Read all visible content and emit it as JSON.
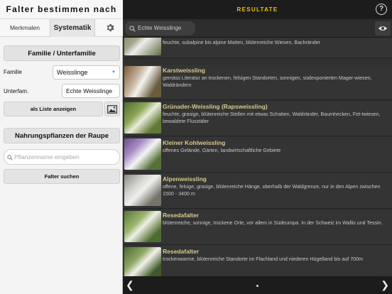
{
  "left_panel": {
    "title": "Falter bestimmen nach",
    "tabs": {
      "merkmalen": "Merkmalen",
      "systematik": "Systematik"
    },
    "section_family": "Familie / Unterfamilie",
    "familie_label": "Familie",
    "familie_value": "Weisslinge",
    "unterfam_label": "Unterfam.",
    "unterfam_value": "Echte Weisslinge",
    "list_button": "als Liste anzeigen",
    "section_plants": "Nahrungspflanzen der Raupe",
    "plant_placeholder": "Pflanzenname eingeben",
    "search_button": "Falter suchen"
  },
  "right_panel": {
    "title": "RESULTATE",
    "search_value": "Echte Weisslinge",
    "rows": [
      {
        "title": "",
        "desc": "feuchte, subalpine bis alpine Matten, blütenreiche Wiesen, Bachränder"
      },
      {
        "title": "Karstweissling",
        "desc": "gemäss Literatur an trockenen, felsigen Standorten, sonnigen, südexponierten Mager-wiesen, Waldrändern"
      },
      {
        "title": "Grünader-Weissling (Rapsweissling)",
        "desc": "feuchte, grasige, blütenreiche Stellen mit etwas Schatten, Waldränder, Baumhecken, Fet-twiesen, bewaldete Flusstäler"
      },
      {
        "title": "Kleiner Kohlweissling",
        "desc": "offenes Gelände, Gärten, landwirtschaftliche Gebiete"
      },
      {
        "title": "Alpenweissling",
        "desc": "offene, felsige, grasige, blütenreiche Hänge, oberhalb der Waldgrenze, nur in den Alpen zwischen 1500 - 3400 m"
      },
      {
        "title": "Resedafalter",
        "desc": "blütenreiche, sonnige, trockene Orte, vor allem in Südeuropa. In der Schweiz im Wallis und Tessin."
      },
      {
        "title": "Resedafalter",
        "desc": "trockenwarme, blütenreiche Standorte im Flachland und niederen Hügelland bis auf 700m"
      }
    ]
  },
  "colors": {
    "accent": "#f2c200",
    "row_title": "#d8c98e"
  },
  "icons": [
    "gear-icon",
    "image-icon",
    "search-icon",
    "help-icon",
    "eye-icon",
    "chevron-left-icon",
    "chevron-right-icon",
    "dropdown-caret-icon"
  ]
}
